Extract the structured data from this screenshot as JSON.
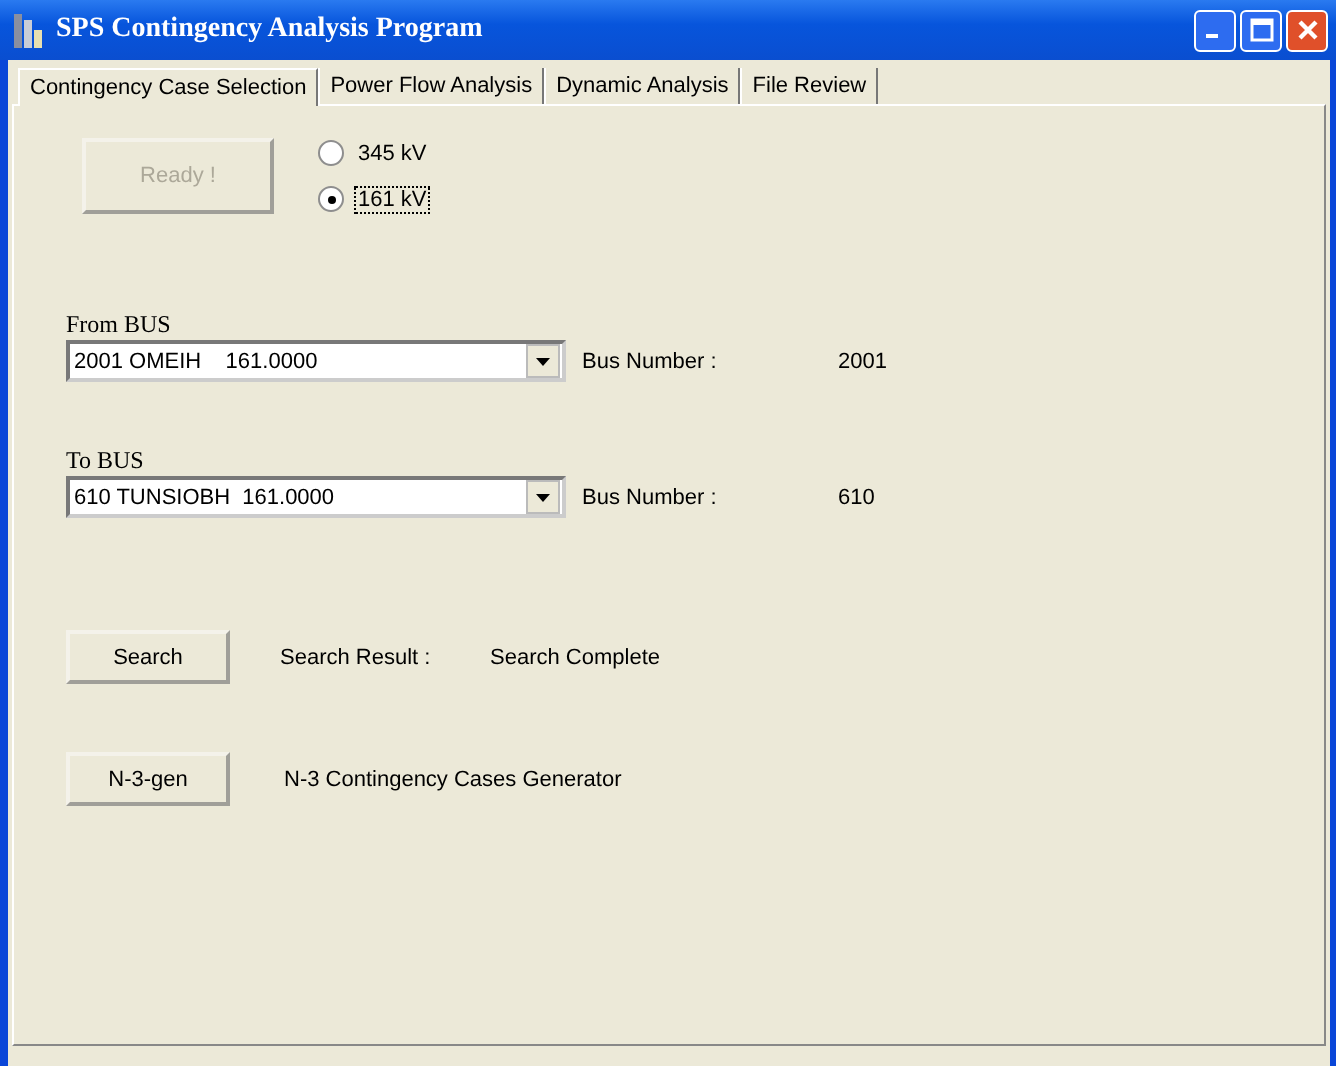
{
  "window": {
    "title": "SPS Contingency Analysis Program"
  },
  "tabs": [
    {
      "label": "Contingency Case Selection",
      "selected": true
    },
    {
      "label": "Power Flow Analysis",
      "selected": false
    },
    {
      "label": "Dynamic Analysis",
      "selected": false
    },
    {
      "label": "File Review",
      "selected": false
    }
  ],
  "ready_button": {
    "label": "Ready !",
    "disabled": true
  },
  "voltage_options": [
    {
      "label": "345 kV",
      "selected": false
    },
    {
      "label": "161 kV",
      "selected": true
    }
  ],
  "from_bus": {
    "label": "From BUS",
    "value": "2001 OMEIH    161.0000",
    "number_label": "Bus Number :",
    "number": "2001"
  },
  "to_bus": {
    "label": "To BUS",
    "value": "610 TUNSIOBH  161.0000",
    "number_label": "Bus Number :",
    "number": "610"
  },
  "search": {
    "button": "Search",
    "result_label": "Search Result :",
    "result": "Search Complete"
  },
  "generator": {
    "button": "N-3-gen",
    "description": "N-3 Contingency Cases Generator"
  }
}
